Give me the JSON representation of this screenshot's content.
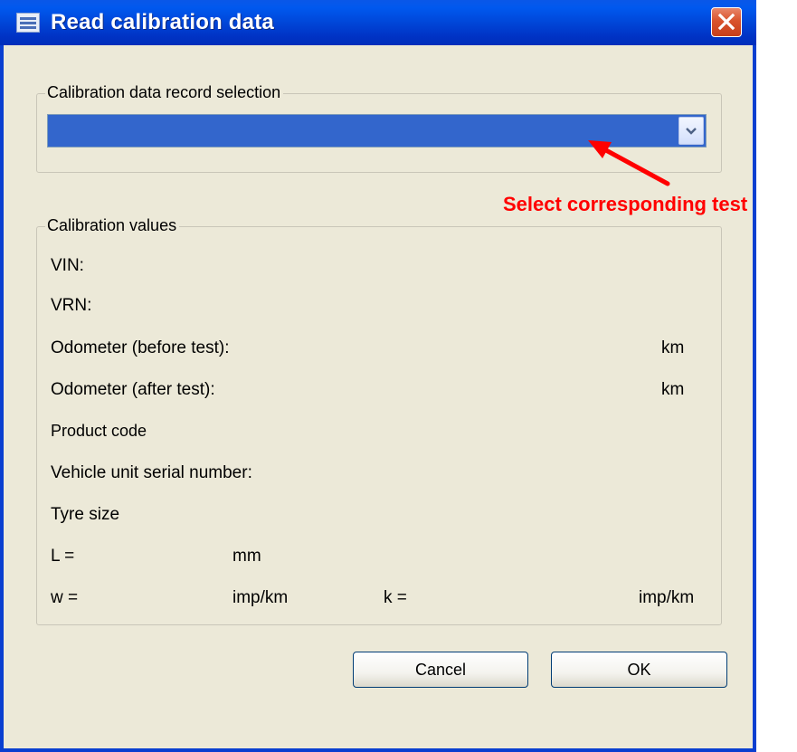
{
  "window": {
    "title": "Read calibration data",
    "close_icon": "close-icon"
  },
  "record_selection": {
    "group_label": "Calibration data record selection",
    "selected_value": ""
  },
  "calibration_values": {
    "group_label": "Calibration values",
    "vin_label": "VIN:",
    "vrn_label": "VRN:",
    "odometer_before_label": "Odometer (before test):",
    "odometer_before_unit": "km",
    "odometer_after_label": "Odometer (after test):",
    "odometer_after_unit": "km",
    "product_code_label": "Product code",
    "vu_serial_label": "Vehicle unit serial number:",
    "tyre_size_label": "Tyre size",
    "l_label": "L =",
    "l_unit": "mm",
    "w_label": "w =",
    "w_unit": "imp/km",
    "k_label": "k =",
    "k_unit": "imp/km"
  },
  "buttons": {
    "cancel": "Cancel",
    "ok": "OK"
  },
  "annotation": {
    "text": "Select corresponding test",
    "color": "#ff0000"
  },
  "colors": {
    "titlebar": "#0046d8",
    "dialog_bg": "#ece9d8",
    "selection_highlight": "#3366cc"
  }
}
